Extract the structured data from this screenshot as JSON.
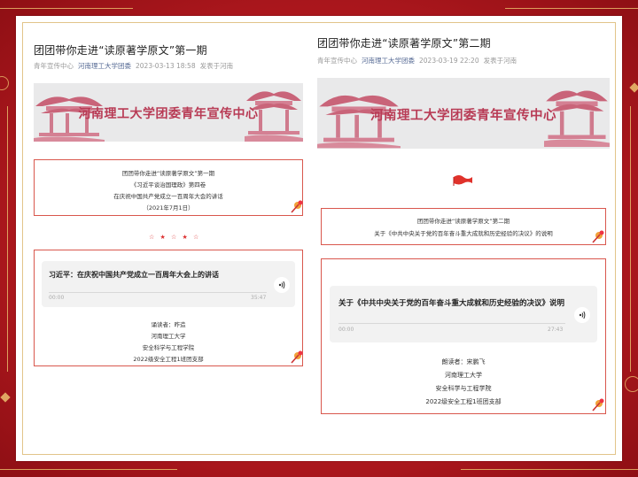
{
  "articles": [
    {
      "title": "团团带你走进“读原著学原文”第一期",
      "meta": {
        "source": "青年宣传中心",
        "account": "河南理工大学团委",
        "datetime": "2023-03-13 18:58",
        "location": "发表于河南"
      },
      "banner": "河南理工大学团委青年宣传中心",
      "info_lines": [
        "团团带你走进“读原著学原文”第一期",
        "《习近平谈治国理政》第四卷",
        "在庆祝中国共产党成立一百周年大会的讲话",
        "（2021年7月1日）"
      ],
      "divider": "☆ ★ ☆ ★ ☆",
      "audio": {
        "title": "习近平：在庆祝中国共产党成立一百周年大会上的讲话",
        "current": "00:00",
        "duration": "35:47",
        "progress": 0
      },
      "credits": [
        "诵读者：昨造",
        "河南理工大学",
        "安全科学与工程学院",
        "2022级安全工程1班团支部"
      ]
    },
    {
      "title": "团团带你走进“读原著学原文”第二期",
      "meta": {
        "source": "青年宣传中心",
        "account": "河南理工大学团委",
        "datetime": "2023-03-19 22:20",
        "location": "发表于河南"
      },
      "banner": "河南理工大学团委青年宣传中心",
      "info_lines": [
        "团团带你走进“读原著学原文”第二期",
        "关于《中共中央关于党的百年奋斗重大成就和历史经验的决议》的说明"
      ],
      "audio": {
        "title": "关于《中共中央关于党的百年奋斗重大成就和历史经验的决议》说明",
        "current": "00:00",
        "duration": "27:43",
        "progress": 0
      },
      "credits": [
        "朗读者：宋鹏飞",
        "河南理工大学",
        "安全科学与工程学院",
        "2022级安全工程1班团支部"
      ]
    }
  ],
  "colors": {
    "background": "#b8181e",
    "gold": "#e8b86a",
    "accent": "#d9574d",
    "link": "#576b95",
    "banner_text": "#b83b55"
  },
  "icons": [
    "volume-icon",
    "flag-icon",
    "brush-flower-icon",
    "pavilion-icon"
  ]
}
